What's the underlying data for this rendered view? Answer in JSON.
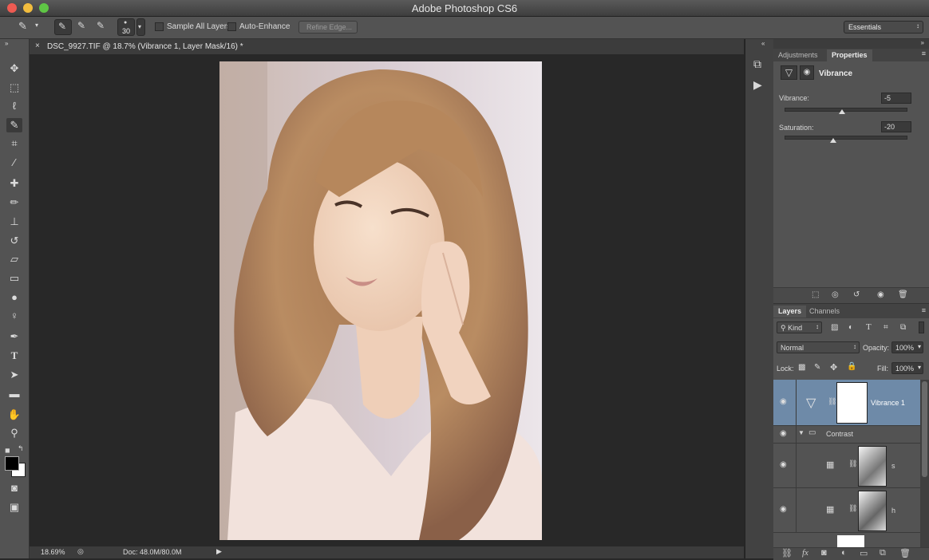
{
  "window": {
    "title": "Adobe Photoshop CS6",
    "workspace": "Essentials"
  },
  "options": {
    "brush_size": "30",
    "sample_all_layers": "Sample All Layers",
    "auto_enhance": "Auto-Enhance",
    "refine_edge": "Refine Edge..."
  },
  "document": {
    "tab_title": "DSC_9927.TIF @ 18.7% (Vibrance 1, Layer Mask/16) *",
    "close_glyph": "×"
  },
  "status": {
    "zoom": "18.69%",
    "doc_info": "Doc: 48.0M/80.0M"
  },
  "properties": {
    "tabs": [
      "Adjustments",
      "Properties"
    ],
    "adjustment_name": "Vibrance",
    "vibrance_label": "Vibrance:",
    "vibrance_value": "-5",
    "vibrance_level": -5,
    "saturation_label": "Saturation:",
    "saturation_value": "-20",
    "saturation_level": -20
  },
  "layers": {
    "tabs": [
      "Layers",
      "Channels"
    ],
    "filter_kind": "Kind",
    "blend_mode": "Normal",
    "opacity_label": "Opacity:",
    "opacity_value": "100%",
    "lock_label": "Lock:",
    "fill_label": "Fill:",
    "fill_value": "100%",
    "items": [
      {
        "name": "Vibrance 1"
      },
      {
        "name": "Contrast"
      },
      {
        "name": "s"
      },
      {
        "name": "h"
      }
    ]
  },
  "colors": {
    "accent_selected": "#6e8aa8",
    "panel": "#535353",
    "canvas": "#282828"
  }
}
